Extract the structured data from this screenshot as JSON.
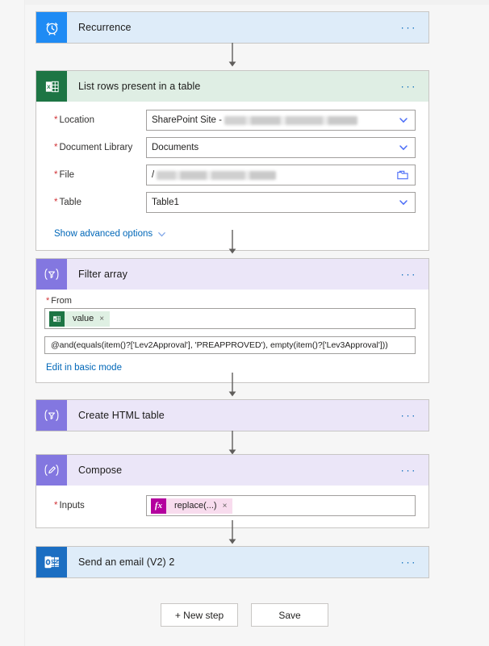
{
  "flow": {
    "steps": [
      {
        "id": "recurrence",
        "title": "Recurrence",
        "icon": "alarm-clock-icon",
        "menu": "···"
      },
      {
        "id": "list-rows",
        "title": "List rows present in a table",
        "icon": "excel-icon",
        "menu": "···",
        "fields": [
          {
            "label": "Location",
            "required": true,
            "value": "SharePoint Site - ",
            "redacted": true,
            "control": "dropdown"
          },
          {
            "label": "Document Library",
            "required": true,
            "value": "Documents",
            "redacted": false,
            "control": "dropdown"
          },
          {
            "label": "File",
            "required": true,
            "value": "/",
            "redacted": true,
            "control": "file-picker"
          },
          {
            "label": "Table",
            "required": true,
            "value": "Table1",
            "redacted": false,
            "control": "dropdown"
          }
        ],
        "advanced_link": "Show advanced options"
      },
      {
        "id": "filter-array",
        "title": "Filter array",
        "icon": "filter-icon",
        "menu": "···",
        "from_label": "From",
        "from_required": true,
        "from_token": "value",
        "from_token_remove": "×",
        "expression": "@and(equals(item()?['Lev2Approval'], 'PREAPPROVED'), empty(item()?['Lev3Approval']))",
        "basic_mode_link": "Edit in basic mode"
      },
      {
        "id": "create-html-table",
        "title": "Create HTML table",
        "icon": "filter-icon",
        "menu": "···"
      },
      {
        "id": "compose",
        "title": "Compose",
        "icon": "compose-pencil-icon",
        "menu": "···",
        "inputs_label": "Inputs",
        "inputs_required": true,
        "inputs_token": "replace(...)",
        "inputs_token_badge": "fx",
        "inputs_token_remove": "×"
      },
      {
        "id": "send-email",
        "title": "Send an email (V2) 2",
        "icon": "outlook-icon",
        "menu": "···"
      }
    ]
  },
  "footer": {
    "new_step_label": "+ New step",
    "save_label": "Save"
  },
  "colors": {
    "accent_blue": "#0067b8",
    "recurrence_tile": "#1f8bf4",
    "excel_tile": "#1d7544",
    "control_tile": "#8377e0",
    "outlook_tile": "#1b6ec2",
    "required_star": "#d13438",
    "fx_badge": "#b4009e",
    "canvas_bg": "#f6f6f6"
  }
}
